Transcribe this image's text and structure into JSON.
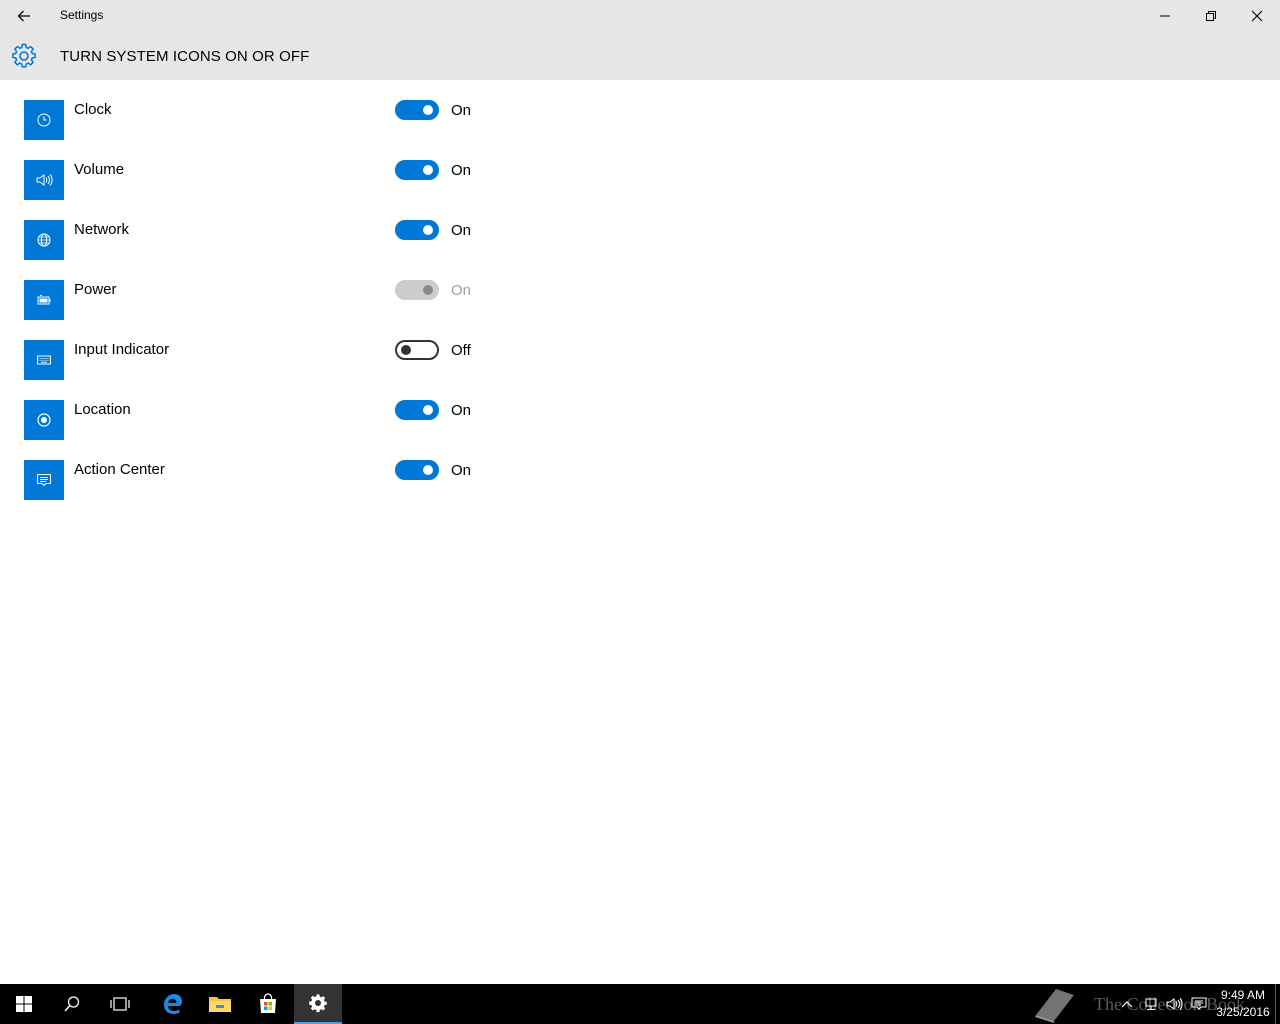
{
  "window": {
    "title": "Settings",
    "back_icon": "back-arrow-icon",
    "controls": [
      "minimize-icon",
      "restore-icon",
      "close-icon"
    ]
  },
  "header": {
    "icon": "gear-icon",
    "title": "TURN SYSTEM ICONS ON OR OFF"
  },
  "settings": [
    {
      "label": "Clock",
      "icon": "clock-icon",
      "state": "On",
      "on": true,
      "disabled": false
    },
    {
      "label": "Volume",
      "icon": "volume-icon",
      "state": "On",
      "on": true,
      "disabled": false
    },
    {
      "label": "Network",
      "icon": "network-globe-icon",
      "state": "On",
      "on": true,
      "disabled": false
    },
    {
      "label": "Power",
      "icon": "battery-icon",
      "state": "On",
      "on": true,
      "disabled": true
    },
    {
      "label": "Input Indicator",
      "icon": "keyboard-icon",
      "state": "Off",
      "on": false,
      "disabled": false
    },
    {
      "label": "Location",
      "icon": "location-icon",
      "state": "On",
      "on": true,
      "disabled": false
    },
    {
      "label": "Action Center",
      "icon": "action-center-icon",
      "state": "On",
      "on": true,
      "disabled": false
    }
  ],
  "taskbar": {
    "buttons": [
      "start-icon",
      "search-icon",
      "task-view-icon",
      "edge-icon",
      "file-explorer-icon",
      "store-icon",
      "settings-gear-icon"
    ],
    "active": "settings-gear-icon",
    "tray_icons": [
      "chevron-up-icon",
      "network-icon",
      "volume-icon",
      "action-center-icon"
    ],
    "time": "9:49 AM",
    "date": "3/25/2016",
    "watermark": "The Collection Book"
  },
  "colors": {
    "accent": "#0078d7",
    "titlebar_bg": "#e6e6e6",
    "taskbar_bg": "#000000",
    "disabled": "#cccccc"
  }
}
